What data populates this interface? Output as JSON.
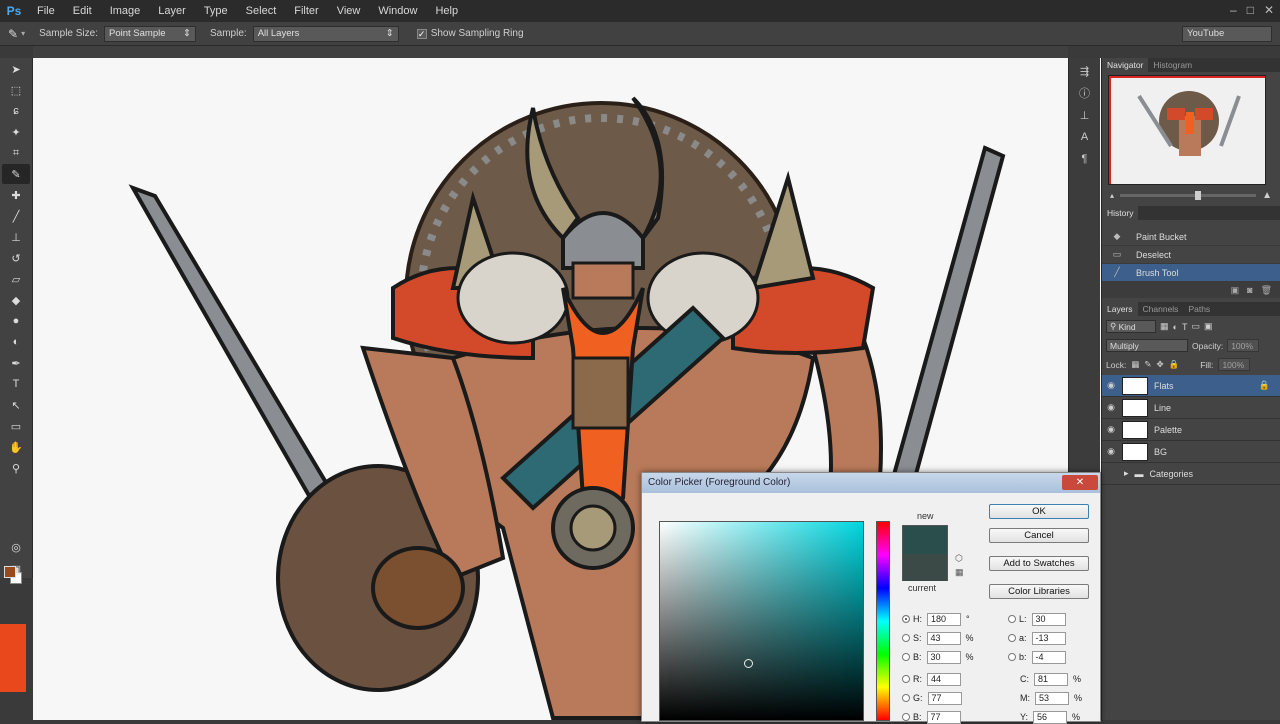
{
  "app": {
    "logo": "Ps"
  },
  "menu": [
    "File",
    "Edit",
    "Image",
    "Layer",
    "Type",
    "Select",
    "Filter",
    "View",
    "Window",
    "Help"
  ],
  "options": {
    "sample_size_label": "Sample Size:",
    "sample_size_value": "Point Sample",
    "sample_label": "Sample:",
    "sample_value": "All Layers",
    "show_ring_label": "Show Sampling Ring",
    "workspace": "YouTube"
  },
  "navigator": {
    "tabs": [
      "Navigator",
      "Histogram"
    ]
  },
  "history": {
    "tab": "History",
    "items": [
      {
        "label": "Paint Bucket",
        "icon": "bucket-icon"
      },
      {
        "label": "Deselect",
        "icon": "deselect-icon"
      },
      {
        "label": "Brush Tool",
        "icon": "brush-icon"
      }
    ]
  },
  "layers": {
    "tabs": [
      "Layers",
      "Channels",
      "Paths"
    ],
    "kind": "Kind",
    "blend_mode": "Multiply",
    "opacity_label": "Opacity:",
    "opacity_value": "100%",
    "lock_label": "Lock:",
    "fill_label": "Fill:",
    "fill_value": "100%",
    "items": [
      {
        "name": "Flats",
        "selected": true
      },
      {
        "name": "Line",
        "selected": false
      },
      {
        "name": "Palette",
        "selected": false
      },
      {
        "name": "BG",
        "selected": false
      },
      {
        "name": "Categories",
        "selected": false
      }
    ]
  },
  "color_picker": {
    "title": "Color Picker (Foreground Color)",
    "close": "✕",
    "new_label": "new",
    "current_label": "current",
    "new_color": "#2a4e4c",
    "current_color": "#3c4a47",
    "buttons": {
      "ok": "OK",
      "cancel": "Cancel",
      "add_swatches": "Add to Swatches",
      "color_libraries": "Color Libraries"
    },
    "fields": {
      "H": {
        "label": "H:",
        "value": "180",
        "unit": "°"
      },
      "S": {
        "label": "S:",
        "value": "43",
        "unit": "%"
      },
      "B": {
        "label": "B:",
        "value": "30",
        "unit": "%"
      },
      "R": {
        "label": "R:",
        "value": "44",
        "unit": ""
      },
      "G": {
        "label": "G:",
        "value": "77",
        "unit": ""
      },
      "Bv": {
        "label": "B:",
        "value": "77",
        "unit": ""
      },
      "L": {
        "label": "L:",
        "value": "30",
        "unit": ""
      },
      "a": {
        "label": "a:",
        "value": "-13",
        "unit": ""
      },
      "b": {
        "label": "b:",
        "value": "-4",
        "unit": ""
      },
      "C": {
        "label": "C:",
        "value": "81",
        "unit": "%"
      },
      "M": {
        "label": "M:",
        "value": "53",
        "unit": "%"
      },
      "Y": {
        "label": "Y:",
        "value": "56",
        "unit": "%"
      }
    }
  },
  "colors": {
    "accent": "#e8481c",
    "selection": "#3c5f8c"
  }
}
